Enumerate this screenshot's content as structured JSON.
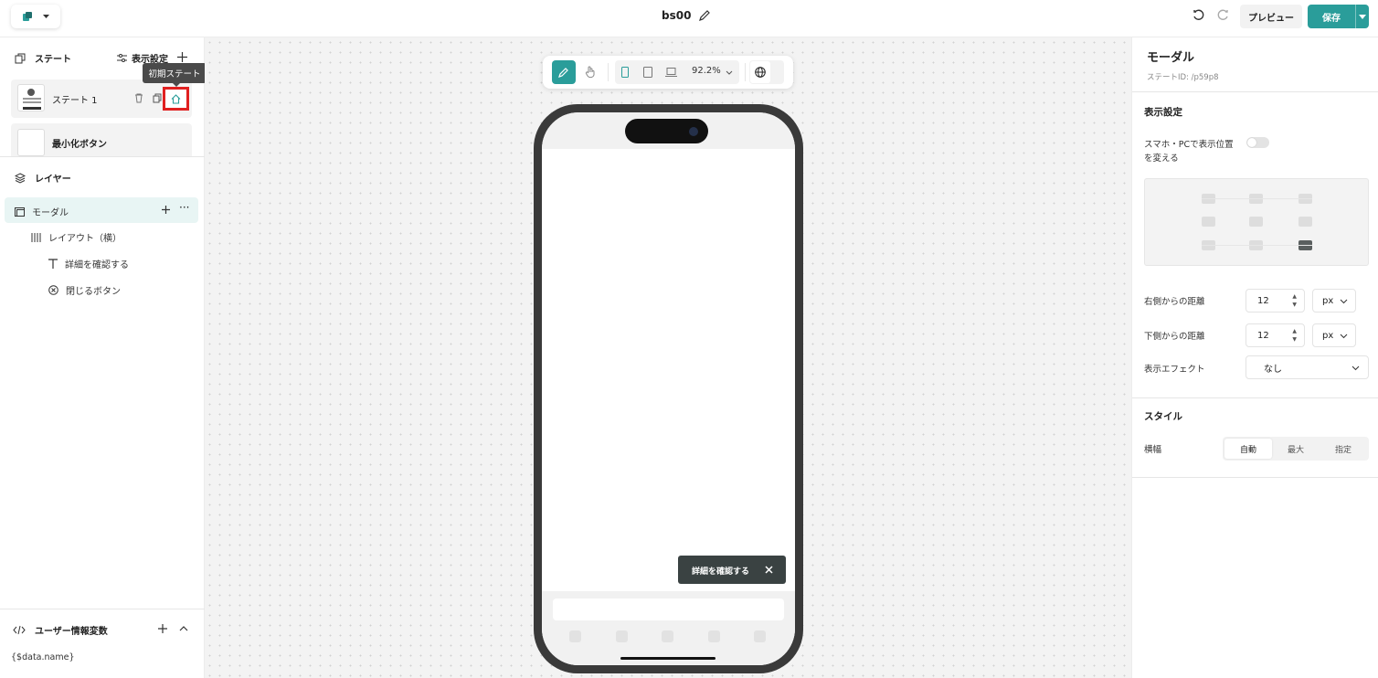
{
  "topbar": {
    "title": "bs00",
    "preview_label": "プレビュー",
    "save_label": "保存"
  },
  "states": {
    "title": "ステート",
    "display_settings_label": "表示設定",
    "tooltip": "初期ステート",
    "items": [
      {
        "label": "ステート 1"
      },
      {
        "label": "最小化ボタン"
      }
    ]
  },
  "layers": {
    "title": "レイヤー",
    "items": [
      {
        "label": "モーダル",
        "icon": "modal-icon"
      },
      {
        "label": "レイアウト（横）",
        "icon": "columns-icon"
      },
      {
        "label": "詳細を確認する",
        "icon": "text-icon"
      },
      {
        "label": "閉じるボタン",
        "icon": "close-circle-icon"
      }
    ]
  },
  "variables": {
    "title": "ユーザー情報変数",
    "items": [
      "{$data.name}"
    ]
  },
  "canvas": {
    "zoom": "92.2%",
    "toast_text": "詳細を確認する"
  },
  "inspector": {
    "title": "モーダル",
    "state_id": "ステートID: /p59p8",
    "display_section": "表示設定",
    "toggle_label_line1": "スマホ・PCで表示位置",
    "toggle_label_line2": "を変える",
    "toggle_on": false,
    "right_distance_label": "右側からの距離",
    "right_distance_value": "12",
    "right_distance_unit": "px",
    "bottom_distance_label": "下側からの距離",
    "bottom_distance_value": "12",
    "bottom_distance_unit": "px",
    "effect_label": "表示エフェクト",
    "effect_value": "なし",
    "style_section": "スタイル",
    "width_label": "横幅",
    "width_options": [
      "自動",
      "最大",
      "指定"
    ],
    "width_selected": "自動"
  },
  "colors": {
    "accent": "#2a9d9a",
    "highlight": "#e8f5f4",
    "toast_bg": "#3a4242",
    "annotation": "#e02020"
  }
}
